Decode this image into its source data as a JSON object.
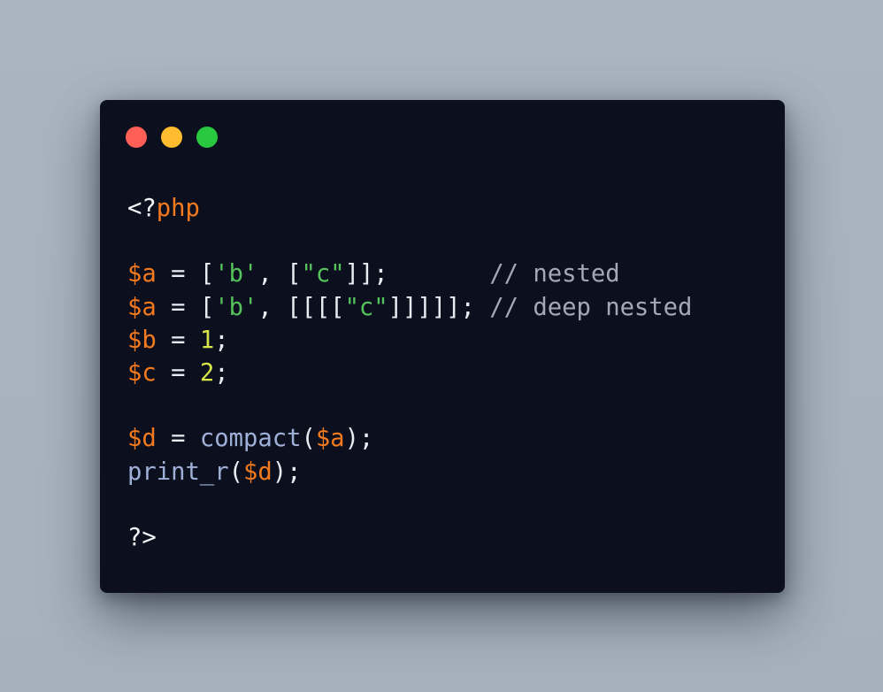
{
  "window": {
    "traffic_lights": [
      {
        "name": "close",
        "color": "#ff5f57"
      },
      {
        "name": "minimize",
        "color": "#febc2e"
      },
      {
        "name": "maximize",
        "color": "#28c840"
      }
    ]
  },
  "colors": {
    "background": "#a8b3bf",
    "window": "#0c101e",
    "keyword": "#f47a1f",
    "variable": "#f47a1f",
    "string": "#56c25b",
    "number": "#d8e54a",
    "function": "#9fb0d8",
    "comment": "#a2a8b4",
    "text": "#e8ebf2"
  },
  "code": {
    "language": "php",
    "lines": [
      [
        {
          "t": "<?",
          "c": "tag"
        },
        {
          "t": "php",
          "c": "kw"
        }
      ],
      [],
      [
        {
          "t": "$a",
          "c": "var"
        },
        {
          "t": " = [",
          "c": "op"
        },
        {
          "t": "'b'",
          "c": "str"
        },
        {
          "t": ", [",
          "c": "punct"
        },
        {
          "t": "\"c\"",
          "c": "str"
        },
        {
          "t": "]];       ",
          "c": "punct"
        },
        {
          "t": "// nested",
          "c": "comment"
        }
      ],
      [
        {
          "t": "$a",
          "c": "var"
        },
        {
          "t": " = [",
          "c": "op"
        },
        {
          "t": "'b'",
          "c": "str"
        },
        {
          "t": ", [[[[",
          "c": "punct"
        },
        {
          "t": "\"c\"",
          "c": "str"
        },
        {
          "t": "]]]]]; ",
          "c": "punct"
        },
        {
          "t": "// deep nested",
          "c": "comment"
        }
      ],
      [
        {
          "t": "$b",
          "c": "var"
        },
        {
          "t": " = ",
          "c": "op"
        },
        {
          "t": "1",
          "c": "num"
        },
        {
          "t": ";",
          "c": "punct"
        }
      ],
      [
        {
          "t": "$c",
          "c": "var"
        },
        {
          "t": " = ",
          "c": "op"
        },
        {
          "t": "2",
          "c": "num"
        },
        {
          "t": ";",
          "c": "punct"
        }
      ],
      [],
      [
        {
          "t": "$d",
          "c": "var"
        },
        {
          "t": " = ",
          "c": "op"
        },
        {
          "t": "compact",
          "c": "fn"
        },
        {
          "t": "(",
          "c": "punct"
        },
        {
          "t": "$a",
          "c": "var"
        },
        {
          "t": ");",
          "c": "punct"
        }
      ],
      [
        {
          "t": "print_r",
          "c": "fn"
        },
        {
          "t": "(",
          "c": "punct"
        },
        {
          "t": "$d",
          "c": "var"
        },
        {
          "t": ");",
          "c": "punct"
        }
      ],
      [],
      [
        {
          "t": "?>",
          "c": "tag"
        }
      ]
    ]
  }
}
